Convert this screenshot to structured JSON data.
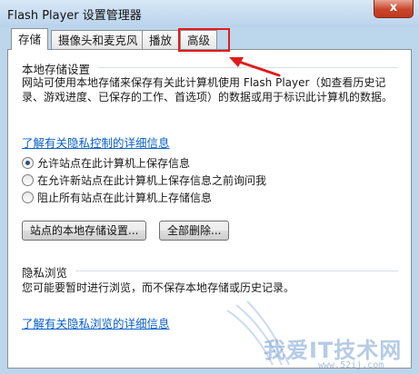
{
  "window": {
    "title": "Flash Player 设置管理器",
    "close_label": "x"
  },
  "tabs": [
    {
      "label": "存储",
      "active": true
    },
    {
      "label": "摄像头和麦克风",
      "active": false
    },
    {
      "label": "播放",
      "active": false
    },
    {
      "label": "高级",
      "active": false
    }
  ],
  "storage": {
    "heading": "本地存储设置",
    "description": "网站可使用本地存储来保存有关此计算机使用 Flash Player（如查看历史记录、游戏进度、已保存的工作、首选项）的数据或用于标识此计算机的数据。",
    "privacy_link": "了解有关隐私控制的详细信息",
    "options": [
      {
        "label": "允许站点在此计算机上保存信息",
        "checked": true
      },
      {
        "label": "在允许新站点在此计算机上保存信息之前询问我",
        "checked": false
      },
      {
        "label": "阻止所有站点在此计算机上存储信息",
        "checked": false
      }
    ],
    "site_settings_button": "站点的本地存储设置...",
    "delete_all_button": "全部删除..."
  },
  "private_browsing": {
    "heading": "隐私浏览",
    "description": "您可能要暂时进行浏览，而不保存本地存储或历史记录。",
    "link": "了解有关隐私浏览的详细信息"
  },
  "watermark": {
    "main": "我爱IT技术网",
    "sub": "www.52ij.com"
  },
  "colors": {
    "highlight": "#e11b1b",
    "link": "#0a5fc9"
  }
}
